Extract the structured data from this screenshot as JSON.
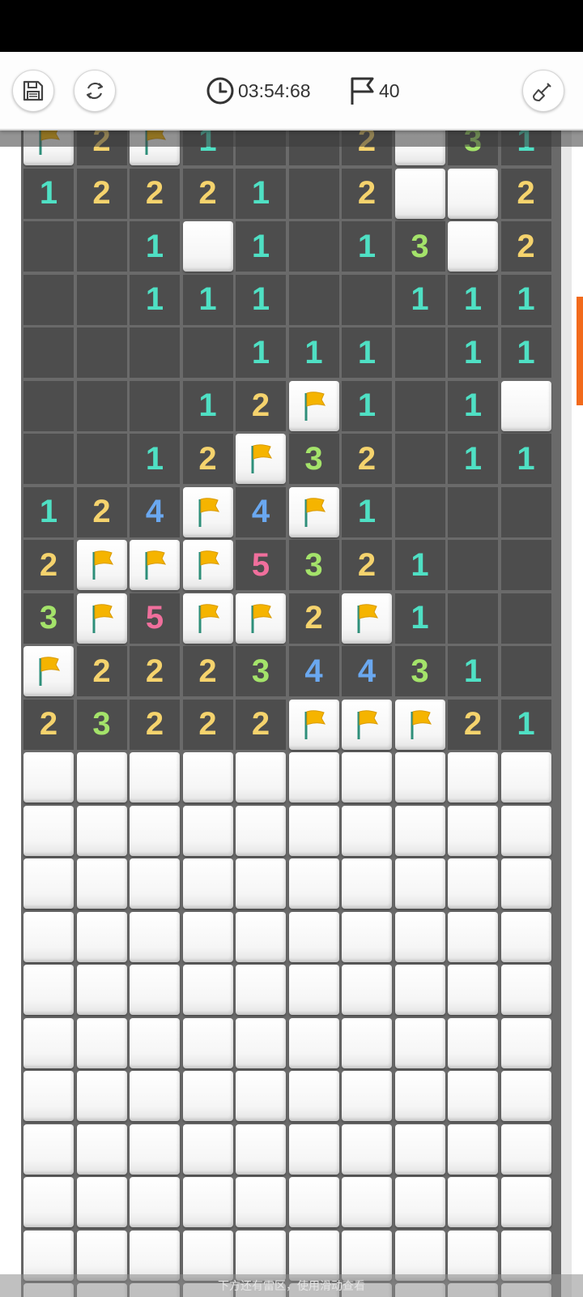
{
  "toolbar": {
    "save_icon": "save-icon",
    "restart_icon": "restart-icon",
    "timer_icon": "clock-icon",
    "timer": "03:54:68",
    "flag_icon": "flag-icon",
    "flags": "40",
    "dig_icon": "shovel-icon"
  },
  "board": {
    "cols": 10,
    "legend": "H = unopened, F = flagged, 0 = empty open, 1-8 = number",
    "rows": [
      [
        "F",
        "2",
        "F",
        "1",
        "0",
        "0",
        "2",
        "H",
        "3",
        "1"
      ],
      [
        "1",
        "2",
        "2",
        "2",
        "1",
        "0",
        "2",
        "H",
        "H",
        "2"
      ],
      [
        "0",
        "0",
        "1",
        "H",
        "1",
        "0",
        "1",
        "3",
        "H",
        "2"
      ],
      [
        "0",
        "0",
        "1",
        "1",
        "1",
        "0",
        "0",
        "1",
        "1",
        "1"
      ],
      [
        "0",
        "0",
        "0",
        "0",
        "1",
        "1",
        "1",
        "0",
        "1",
        "1"
      ],
      [
        "0",
        "0",
        "0",
        "1",
        "2",
        "F",
        "1",
        "0",
        "1",
        "H"
      ],
      [
        "0",
        "0",
        "1",
        "2",
        "F",
        "3",
        "2",
        "0",
        "1",
        "1"
      ],
      [
        "1",
        "2",
        "4",
        "F",
        "4",
        "F",
        "1",
        "0",
        "0",
        "0"
      ],
      [
        "2",
        "F",
        "F",
        "F",
        "5",
        "3",
        "2",
        "1",
        "0",
        "0"
      ],
      [
        "3",
        "F",
        "5",
        "F",
        "F",
        "2",
        "F",
        "1",
        "0",
        "0"
      ],
      [
        "F",
        "2",
        "2",
        "2",
        "3",
        "4",
        "4",
        "3",
        "1",
        "0"
      ],
      [
        "2",
        "3",
        "2",
        "2",
        "2",
        "F",
        "F",
        "F",
        "2",
        "1"
      ],
      [
        "H",
        "H",
        "H",
        "H",
        "H",
        "H",
        "H",
        "H",
        "H",
        "H"
      ],
      [
        "H",
        "H",
        "H",
        "H",
        "H",
        "H",
        "H",
        "H",
        "H",
        "H"
      ],
      [
        "H",
        "H",
        "H",
        "H",
        "H",
        "H",
        "H",
        "H",
        "H",
        "H"
      ],
      [
        "H",
        "H",
        "H",
        "H",
        "H",
        "H",
        "H",
        "H",
        "H",
        "H"
      ],
      [
        "H",
        "H",
        "H",
        "H",
        "H",
        "H",
        "H",
        "H",
        "H",
        "H"
      ],
      [
        "H",
        "H",
        "H",
        "H",
        "H",
        "H",
        "H",
        "H",
        "H",
        "H"
      ],
      [
        "H",
        "H",
        "H",
        "H",
        "H",
        "H",
        "H",
        "H",
        "H",
        "H"
      ],
      [
        "H",
        "H",
        "H",
        "H",
        "H",
        "H",
        "H",
        "H",
        "H",
        "H"
      ],
      [
        "H",
        "H",
        "H",
        "H",
        "H",
        "H",
        "H",
        "H",
        "H",
        "H"
      ],
      [
        "H",
        "H",
        "H",
        "H",
        "H",
        "H",
        "H",
        "H",
        "H",
        "H"
      ],
      [
        "H",
        "H",
        "H",
        "H",
        "H",
        "H",
        "H",
        "H",
        "H",
        "H"
      ]
    ]
  },
  "hint": "下方还有雷区，使用滑动查看",
  "colors": {
    "n1": "#4fe0c4",
    "n2": "#f5d36d",
    "n3": "#a4e36a",
    "n4": "#6aa8f0",
    "n5": "#f06f9c",
    "accent": "#f26a1b",
    "flag": "#f5b400"
  }
}
